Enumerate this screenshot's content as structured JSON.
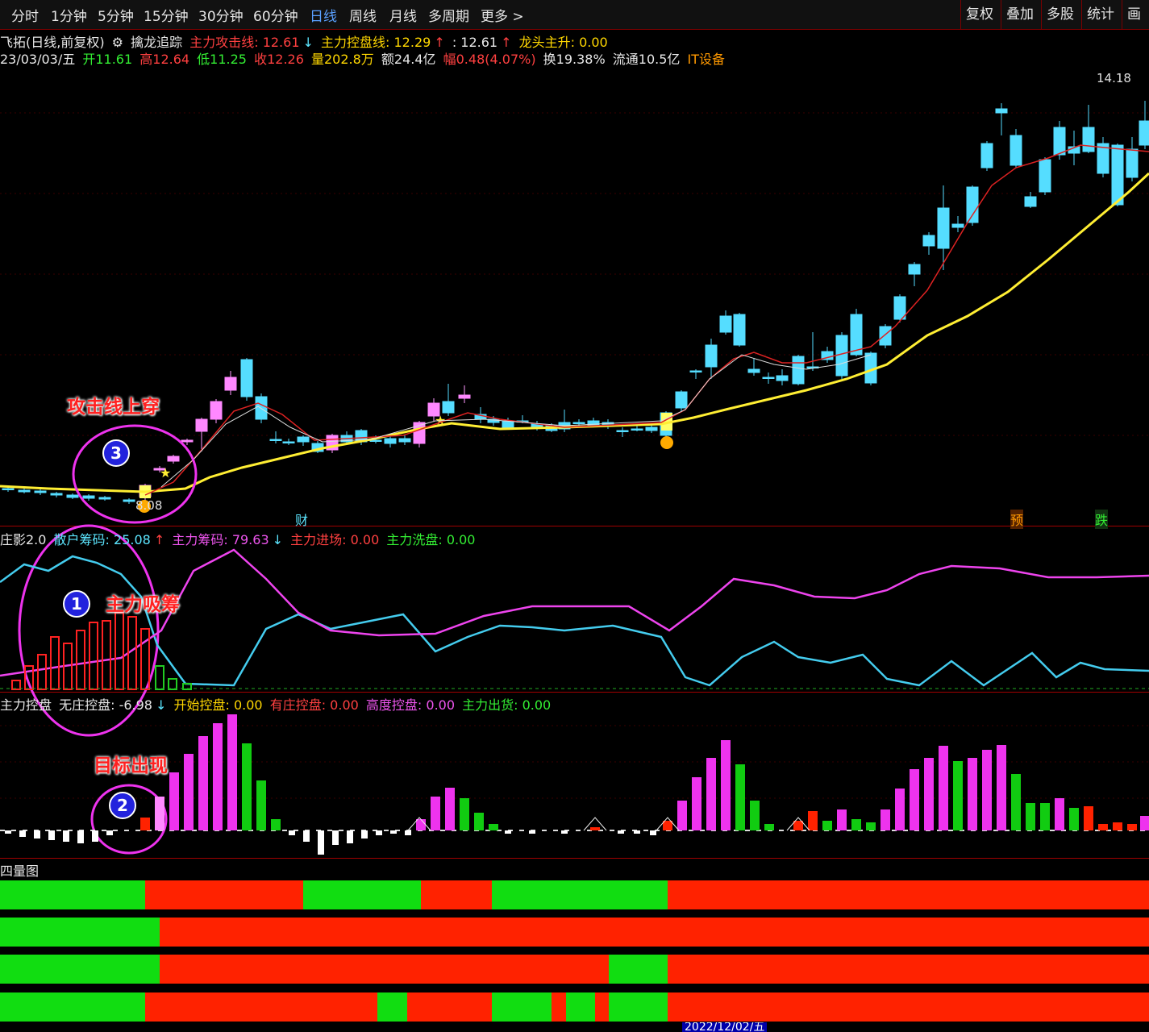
{
  "toolbar": {
    "tabs": [
      "分时",
      "1分钟",
      "5分钟",
      "15分钟",
      "30分钟",
      "60分钟",
      "日线",
      "周线",
      "月线",
      "多周期",
      "更多 >"
    ],
    "active_tab": "日线",
    "right_buttons": [
      "复权",
      "叠加",
      "多股",
      "统计",
      "画线"
    ]
  },
  "header": {
    "stock": "飞拓(日线,前复权)",
    "indicator": "擒龙追踪",
    "attack_line": "主力攻击线: 12.61",
    "control_line": "主力控盘线: 12.29",
    "third_value": ": 12.61",
    "dragon": "龙头主升: 0.00"
  },
  "quote": {
    "date": "23/03/03/五",
    "open": "开11.61",
    "high": "高12.64",
    "low": "低11.25",
    "close": "收12.26",
    "volume": "量202.8万",
    "amount": "额24.4亿",
    "change": "幅0.48(4.07%)",
    "turnover": "换19.38%",
    "float": "流通10.5亿",
    "sector": "IT设备"
  },
  "price_labels": {
    "high": "14.18",
    "low": "8.08"
  },
  "markers": {
    "cai": "财",
    "yu": "预",
    "die": "跌"
  },
  "panel2": {
    "title": "庄影2.0",
    "retail": "散户筹码: 25.08",
    "main_chips": "主力筹码: 79.63",
    "main_enter": "主力进场: 0.00",
    "main_wash": "主力洗盘: 0.00"
  },
  "panel3": {
    "title": "主力控盘",
    "no_control": "无庄控盘: -6.98",
    "start": "开始控盘: 0.00",
    "has_control": "有庄控盘: 0.00",
    "high_control": "高度控盘: 0.00",
    "ship": "主力出货: 0.00"
  },
  "panel4": {
    "title": "四量图"
  },
  "annotations": {
    "a1": "主力吸筹",
    "a2": "目标出现",
    "a3": "攻击线上穿",
    "n1": "1",
    "n2": "2",
    "n3": "3"
  },
  "bottom_axis": {
    "label": "2022/12/02/五"
  },
  "colors": {
    "up": "#ff88ff",
    "down": "#55ddff",
    "red": "#ff2200",
    "green": "#11dd11",
    "yellow": "#ffee33"
  }
}
